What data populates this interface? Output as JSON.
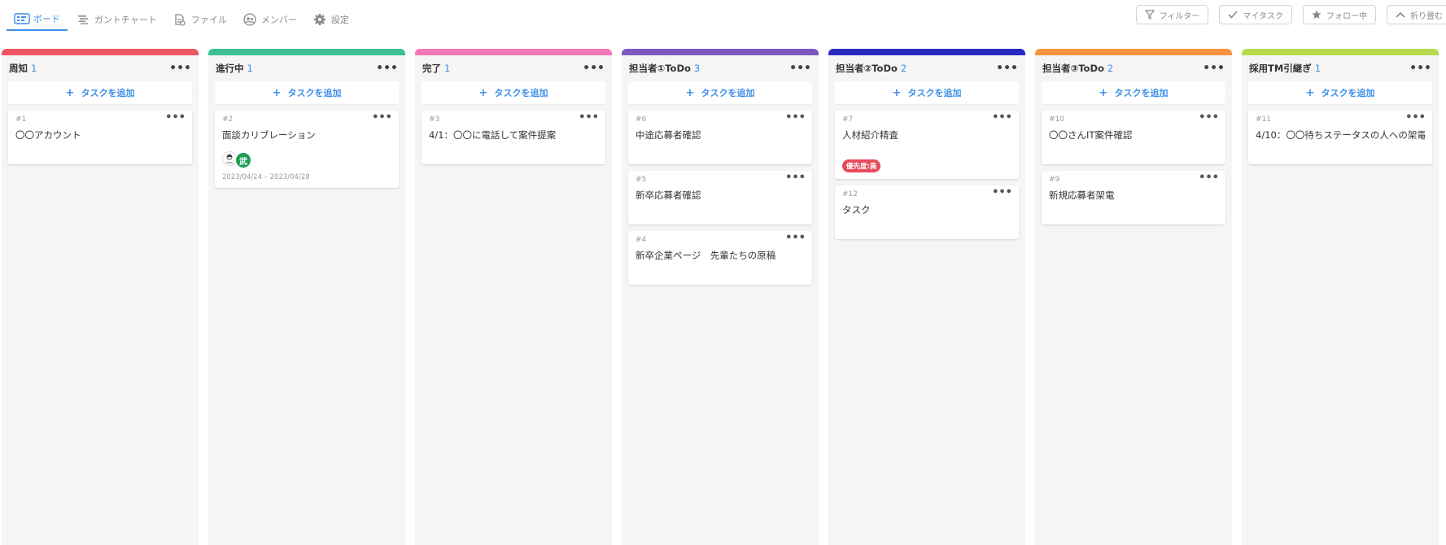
{
  "tabs": [
    {
      "label": "ボード",
      "icon": "board-icon"
    },
    {
      "label": "ガントチャート",
      "icon": "gantt-icon"
    },
    {
      "label": "ファイル",
      "icon": "file-icon"
    },
    {
      "label": "メンバー",
      "icon": "members-icon"
    },
    {
      "label": "設定",
      "icon": "gear-icon"
    }
  ],
  "right_buttons": {
    "filter": "フィルター",
    "my_task": "マイタスク",
    "following": "フォロー中",
    "collapse": "折り畳む"
  },
  "add_task_label": "タスクを追加",
  "colors": {
    "accent": "#3d8fe8",
    "priority_badge": "#e54b5a"
  },
  "columns": [
    {
      "title": "周知",
      "count": "1",
      "color": "#ef5561",
      "cards": [
        {
          "num": "#1",
          "title": "〇〇アカウント"
        }
      ]
    },
    {
      "title": "進行中",
      "count": "1",
      "color": "#3cbf94",
      "cards": [
        {
          "num": "#2",
          "title": "面談カリブレーション",
          "avatar_text": "武",
          "date": "2023/04/24 – 2023/04/28"
        }
      ]
    },
    {
      "title": "完了",
      "count": "1",
      "color": "#f279b8",
      "cards": [
        {
          "num": "#3",
          "title": "4/1：〇〇に電話して案件提案"
        }
      ]
    },
    {
      "title": "担当者①ToDo",
      "count": "3",
      "color": "#7b59bf",
      "cards": [
        {
          "num": "#6",
          "title": "中途応募者確認"
        },
        {
          "num": "#5",
          "title": "新卒応募者確認"
        },
        {
          "num": "#4",
          "title": "新卒企業ページ　先輩たちの原稿"
        }
      ]
    },
    {
      "title": "担当者②ToDo",
      "count": "2",
      "color": "#2a2ac2",
      "cards": [
        {
          "num": "#7",
          "title": "人材紹介精査",
          "badge": "優先度:高"
        },
        {
          "num": "#12",
          "title": "タスク"
        }
      ]
    },
    {
      "title": "担当者③ToDo",
      "count": "2",
      "color": "#f79340",
      "cards": [
        {
          "num": "#10",
          "title": "〇〇さんIT案件確認"
        },
        {
          "num": "#9",
          "title": "新規応募者架電"
        }
      ]
    },
    {
      "title": "採用TM引継ぎ",
      "count": "1",
      "color": "#b6dc4e",
      "cards": [
        {
          "num": "#11",
          "title": "4/10：〇〇待ちステータスの人への架電"
        }
      ]
    }
  ]
}
